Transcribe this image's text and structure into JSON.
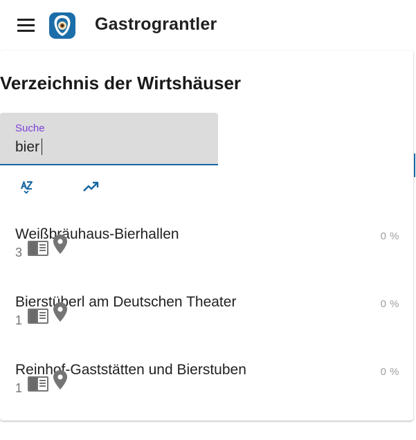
{
  "app": {
    "title": "Gastrograntler",
    "logo_icon": "gastrograntler-logo-icon",
    "menu_icon": "hamburger-menu-icon"
  },
  "page": {
    "title": "Verzeichnis der Wirtshäuser"
  },
  "search": {
    "label": "Suche",
    "value": "bier"
  },
  "sort": {
    "alphabetical_icon": "sort-alphabetical-icon",
    "trending_icon": "trending-up-icon"
  },
  "list": [
    {
      "name": "Weißbräuhaus-Bierhallen",
      "count": "3",
      "percent": "0 %"
    },
    {
      "name": "Bierstüberl am Deutschen Theater",
      "count": "1",
      "percent": "0 %"
    },
    {
      "name": "Reinhof-Gaststätten und Bierstuben",
      "count": "1",
      "percent": "0 %"
    }
  ],
  "colors": {
    "accent": "#1565a0",
    "label": "#7b3fd6",
    "icon_gray": "#757575"
  }
}
